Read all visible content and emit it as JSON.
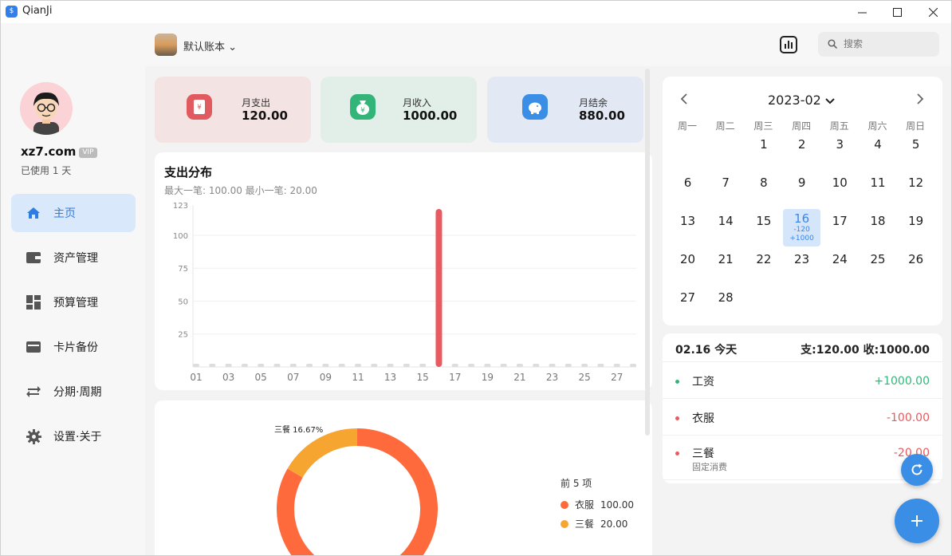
{
  "window": {
    "title": "QianJi",
    "min_icon": "minimize-icon",
    "max_icon": "maximize-icon",
    "close_icon": "close-icon"
  },
  "user": {
    "name": "xz7.com",
    "badge": "VIP",
    "usage": "已使用 1 天"
  },
  "sidebar": {
    "items": [
      {
        "label": "主页",
        "icon": "home-icon",
        "active": true
      },
      {
        "label": "资产管理",
        "icon": "wallet-icon",
        "active": false
      },
      {
        "label": "预算管理",
        "icon": "dashboard-icon",
        "active": false
      },
      {
        "label": "卡片备份",
        "icon": "card-icon",
        "active": false
      },
      {
        "label": "分期·周期",
        "icon": "repeat-icon",
        "active": false
      },
      {
        "label": "设置·关于",
        "icon": "gear-icon",
        "active": false
      }
    ]
  },
  "header": {
    "book_name": "默认账本",
    "search_placeholder": "搜索"
  },
  "summary": {
    "expense": {
      "label": "月支出",
      "value": "120.00",
      "color": "#f3e3e3",
      "icon_color": "#e05a5f"
    },
    "income": {
      "label": "月收入",
      "value": "1000.00",
      "color": "#e2efe8",
      "icon_color": "#33b57a"
    },
    "balance": {
      "label": "月结余",
      "value": "880.00",
      "color": "#e3e9f4",
      "icon_color": "#3a8ee6"
    }
  },
  "distribution": {
    "title": "支出分布",
    "subtitle": "最大一笔: 100.00 最小一笔: 20.00"
  },
  "chart_data": [
    {
      "type": "bar",
      "title": "支出分布",
      "xlabel": "",
      "ylabel": "",
      "ylim": [
        0,
        123
      ],
      "yticks": [
        25,
        50,
        75,
        100,
        123
      ],
      "x_tick_labels": [
        "01",
        "03",
        "05",
        "07",
        "09",
        "11",
        "13",
        "15",
        "17",
        "19",
        "21",
        "23",
        "25",
        "27"
      ],
      "categories": [
        "01",
        "02",
        "03",
        "04",
        "05",
        "06",
        "07",
        "08",
        "09",
        "10",
        "11",
        "12",
        "13",
        "14",
        "15",
        "16",
        "17",
        "18",
        "19",
        "20",
        "21",
        "22",
        "23",
        "24",
        "25",
        "26",
        "27",
        "28"
      ],
      "values": [
        0,
        0,
        0,
        0,
        0,
        0,
        0,
        0,
        0,
        0,
        0,
        0,
        0,
        0,
        0,
        120,
        0,
        0,
        0,
        0,
        0,
        0,
        0,
        0,
        0,
        0,
        0,
        0
      ],
      "bar_color": "#e85a5f",
      "zero_color": "#dddddd",
      "grid": true
    },
    {
      "type": "pie",
      "title": "",
      "legend_title": "前 5 项",
      "slices": [
        {
          "name": "衣服",
          "value": 100.0,
          "display": "100.00",
          "color": "#ff6a3d"
        },
        {
          "name": "三餐",
          "value": 20.0,
          "display": "20.00",
          "color": "#f7a531"
        }
      ],
      "annotation": "三餐 16.67%",
      "legend_placement": "right"
    }
  ],
  "calendar": {
    "month": "2023-02",
    "weekdays": [
      "周一",
      "周二",
      "周三",
      "周四",
      "周五",
      "周六",
      "周日"
    ],
    "first_weekday_index": 2,
    "days": 28,
    "selected_day": 16,
    "selected_expense": "-120",
    "selected_income": "+1000"
  },
  "transactions": {
    "date": "02.16 今天",
    "summary": "支:120.00 收:1000.00",
    "items": [
      {
        "name": "工资",
        "note": "",
        "amount": "+1000.00",
        "color": "#33b57a"
      },
      {
        "name": "衣服",
        "note": "",
        "amount": "-100.00",
        "color": "#e85a5f"
      },
      {
        "name": "三餐",
        "note": "固定消费",
        "amount": "-20.00",
        "color": "#e85a5f"
      }
    ]
  }
}
